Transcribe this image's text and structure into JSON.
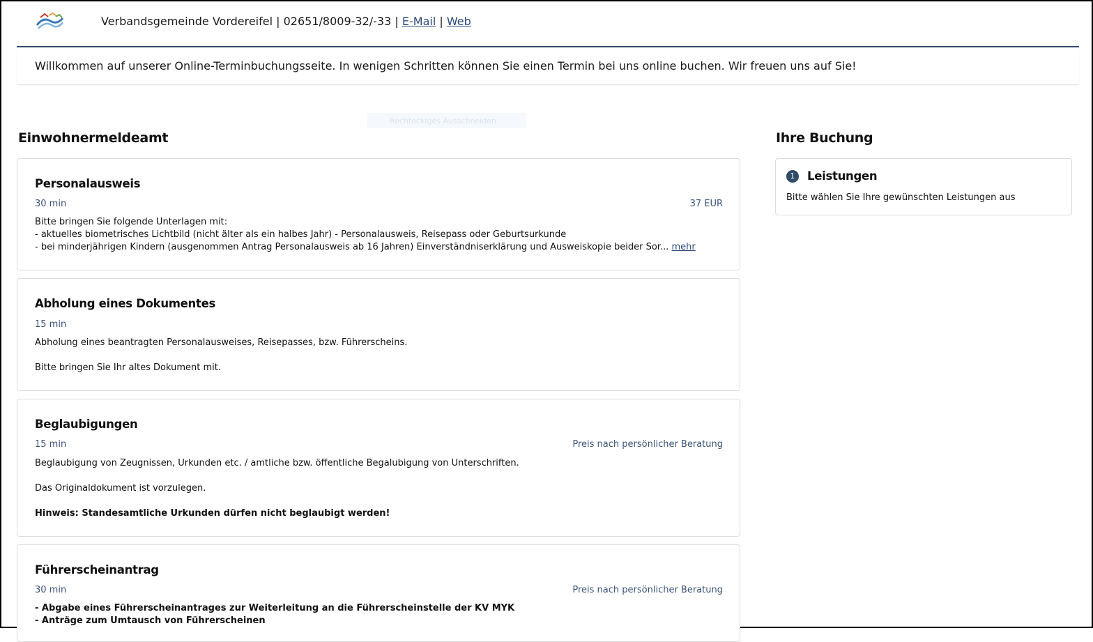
{
  "header": {
    "org_name": "Verbandsgemeinde Vordereifel",
    "phone": "02651/8009-32/-33",
    "sep": "|",
    "email_label": "E-Mail",
    "web_label": "Web",
    "welcome": "Willkommen auf unserer Online-Terminbuchungsseite. In wenigen Schritten können Sie einen Termin bei uns online buchen. Wir freuen uns auf Sie!"
  },
  "overlay": {
    "ghost_label": "Rechteckiges Ausschneiden"
  },
  "services": {
    "section_title": "Einwohnermeldeamt",
    "items": [
      {
        "title": "Personalausweis",
        "duration": "30 min",
        "price": "37 EUR",
        "lines": [
          "Bitte bringen Sie folgende Unterlagen mit:",
          "- aktuelles biometrisches Lichtbild (nicht älter als ein halbes Jahr) - Personalausweis, Reisepass oder Geburtsurkunde",
          "- bei minderjährigen Kindern (ausgenommen Antrag Personalausweis ab 16 Jahren) Einverständniserklärung und Ausweiskopie beider Sor..."
        ],
        "more_label": "mehr"
      },
      {
        "title": "Abholung eines Dokumentes",
        "duration": "15 min",
        "lines": [
          "Abholung eines beantragten Personalausweises, Reisepasses, bzw. Führerscheins.",
          "Bitte bringen Sie Ihr altes Dokument mit."
        ]
      },
      {
        "title": "Beglaubigungen",
        "duration": "15 min",
        "price": "Preis nach persönlicher Beratung",
        "lines": [
          "Beglaubigung von Zeugnissen, Urkunden etc. / amtliche bzw. öffentliche Begalubigung von Unterschriften.",
          "Das Originaldokument ist vorzulegen.",
          "Hinweis: Standesamtliche Urkunden dürfen nicht beglaubigt werden!"
        ]
      },
      {
        "title": "Führerscheinantrag",
        "duration": "30 min",
        "price": "Preis nach persönlicher Beratung",
        "lines": [
          "- Abgabe eines Führerscheinantrages zur Weiterleitung an die Führerscheinstelle der KV MYK",
          "- Anträge zum Umtausch von Führerscheinen"
        ]
      }
    ]
  },
  "booking": {
    "title": "Ihre Buchung",
    "step_number": "1",
    "step_label": "Leistungen",
    "step_hint": "Bitte wählen Sie Ihre gewünschten Leistungen aus"
  },
  "colors": {
    "accent": "#324a6a",
    "link": "#2d4a7a",
    "muted": "#3b5378"
  }
}
